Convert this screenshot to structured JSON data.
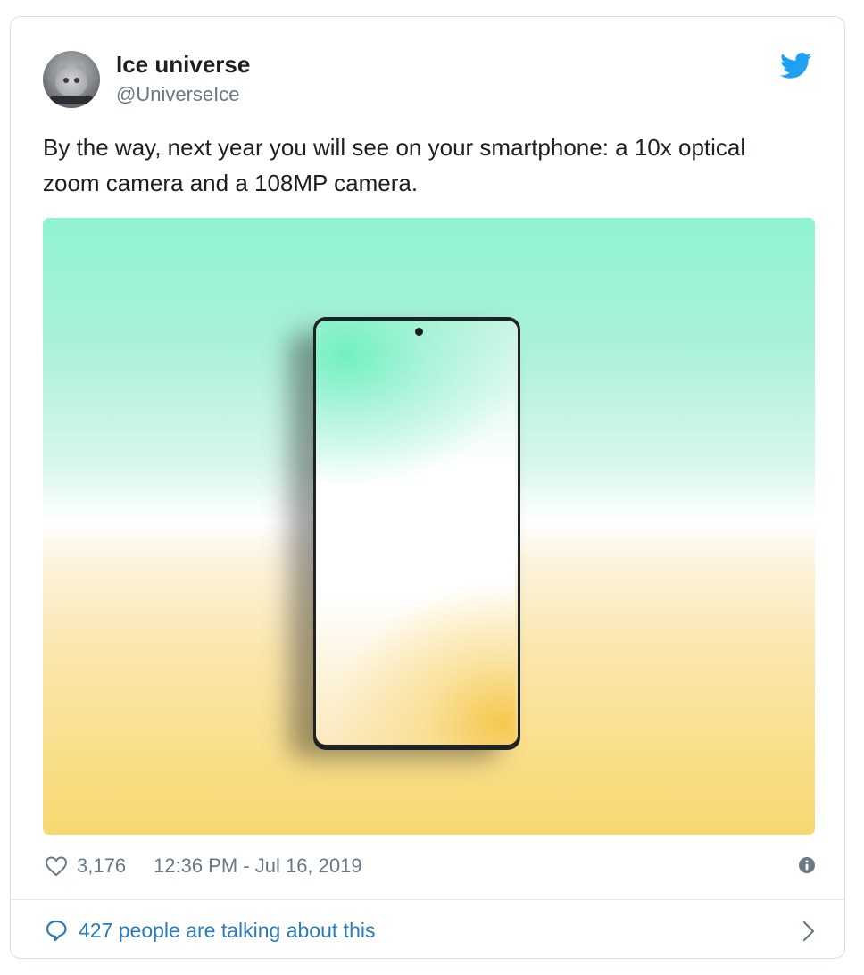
{
  "author": {
    "display_name": "Ice universe",
    "handle": "@UniverseIce",
    "avatar_icon": "cat-avatar"
  },
  "tweet": {
    "text": "By the way, next year you will see on your smartphone: a 10x optical zoom camera and a 108MP camera."
  },
  "media": {
    "description_icon": "phone-render-image"
  },
  "footer": {
    "likes": "3,176",
    "timestamp": "12:36 PM - Jul 16, 2019",
    "like_icon": "heart-icon",
    "info_icon": "info-icon"
  },
  "conversation": {
    "label": "427 people are talking about this",
    "icon": "speech-bubble-icon",
    "chevron": "chevron-right-icon"
  },
  "colors": {
    "text_primary": "#1c2022",
    "text_secondary": "#697882",
    "link": "#2b7bb9",
    "twitter_blue": "#1da1f2",
    "border": "#e1e8ed"
  }
}
